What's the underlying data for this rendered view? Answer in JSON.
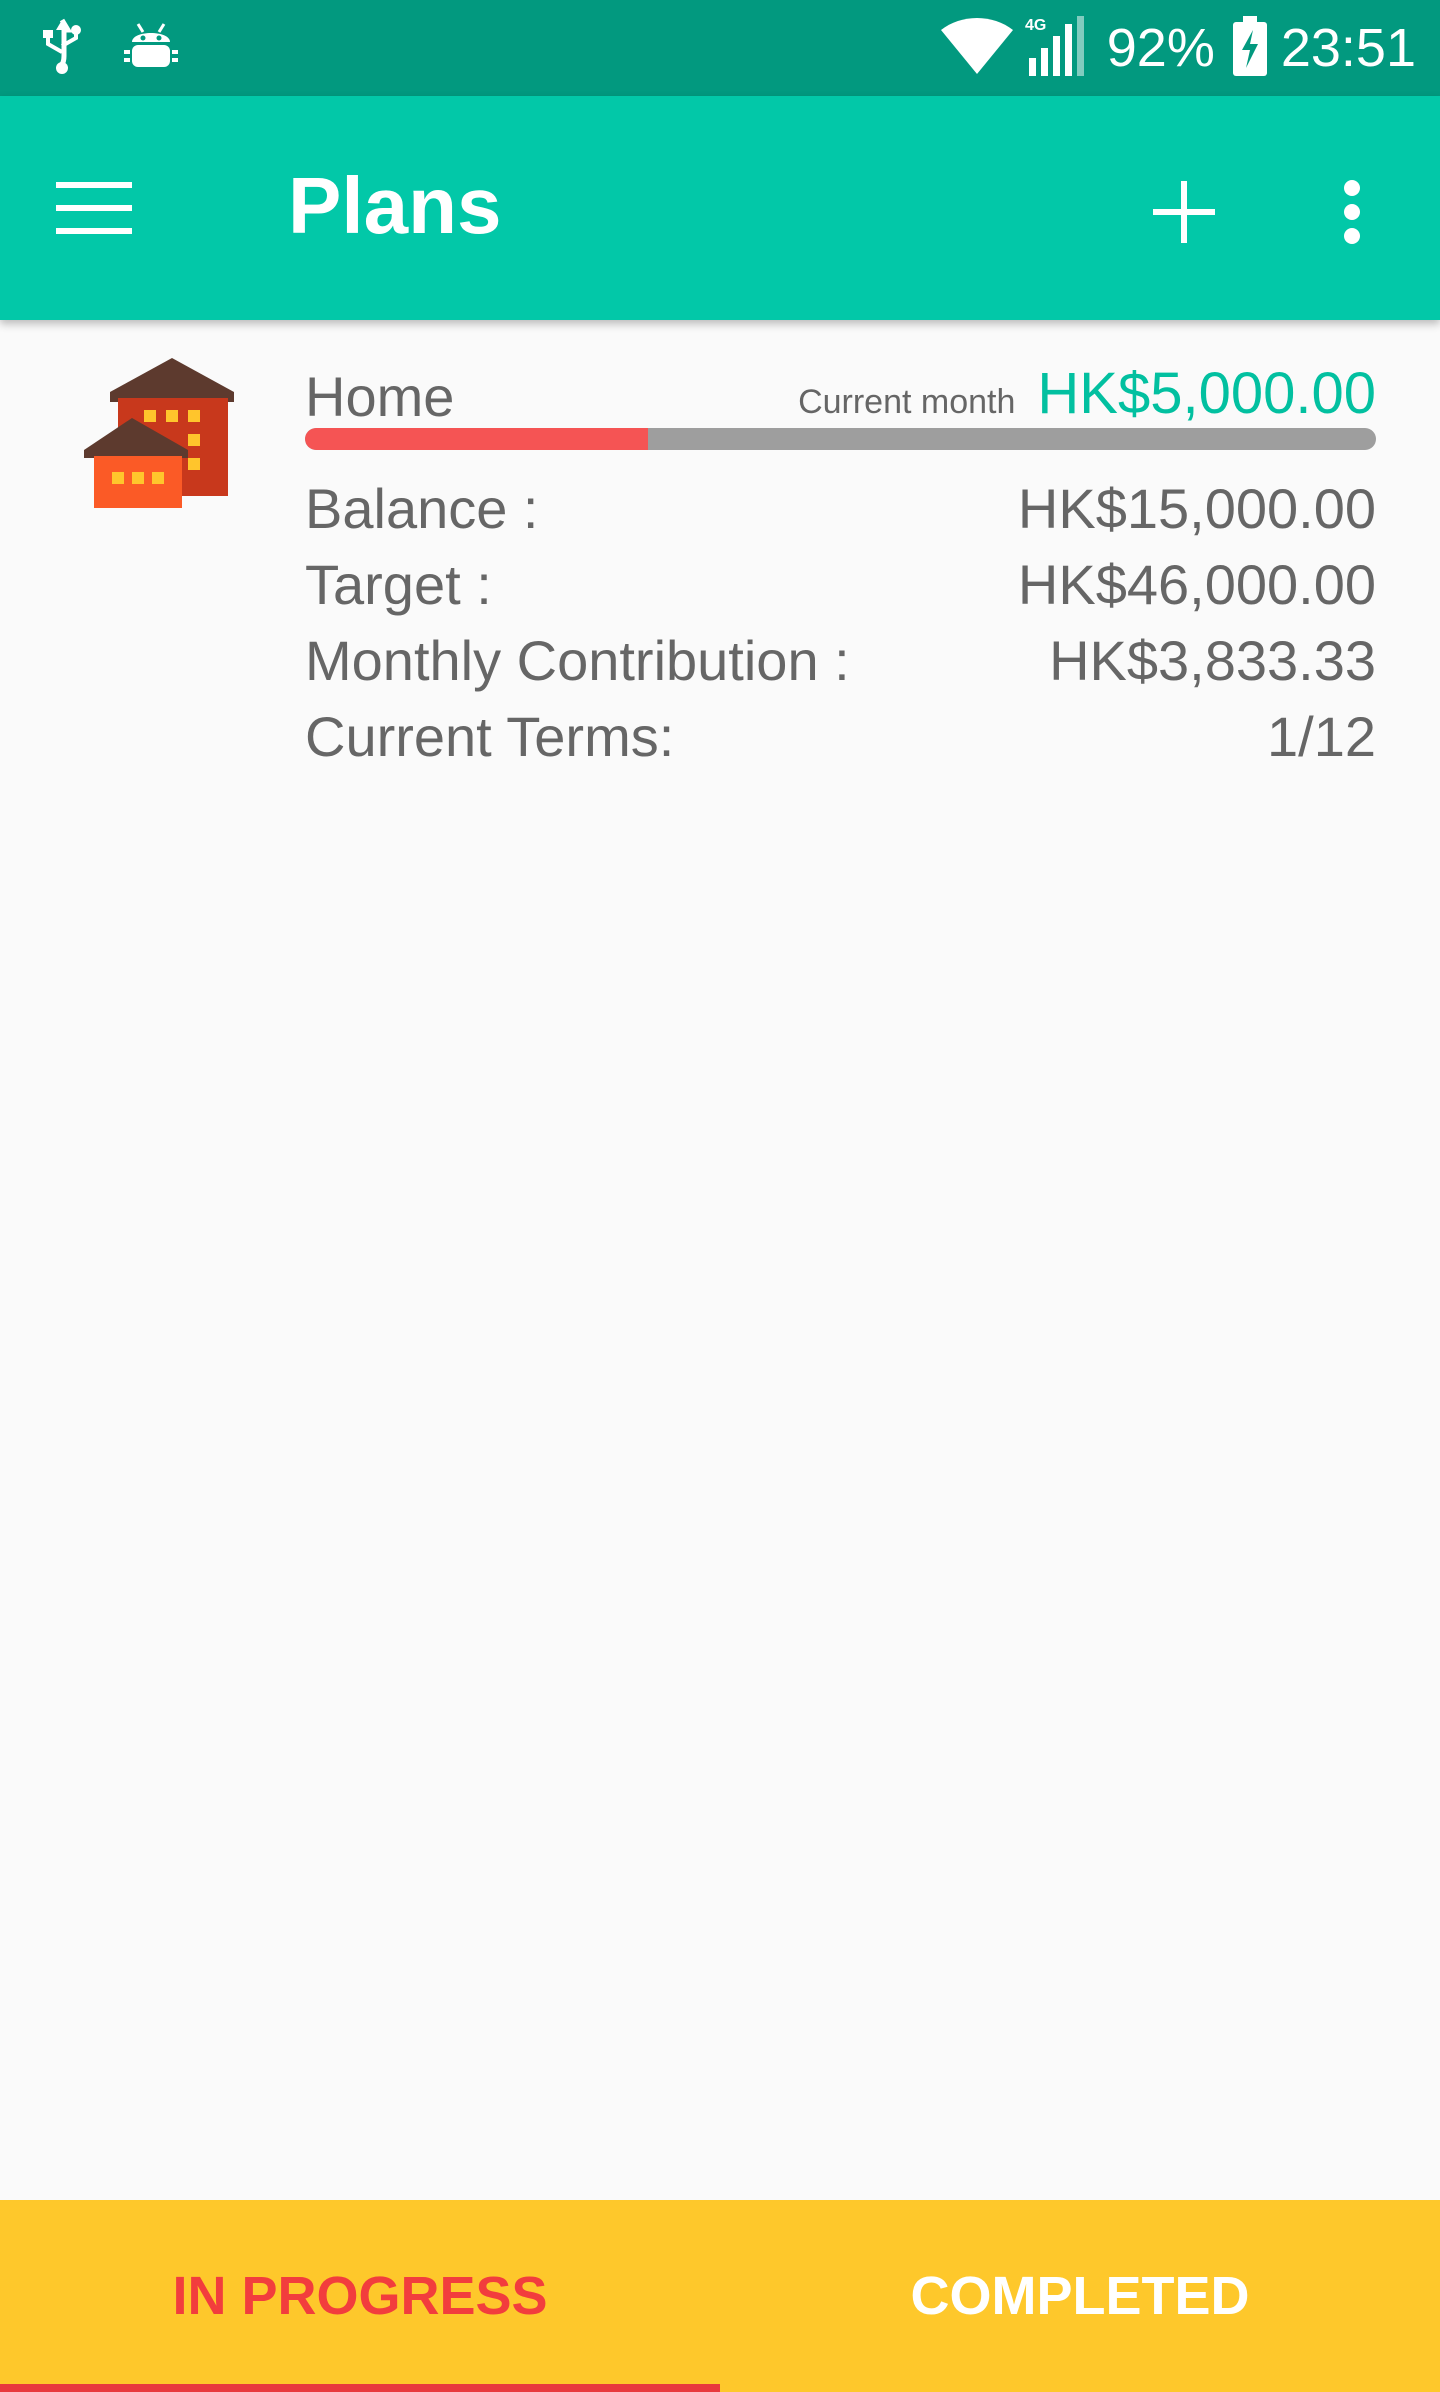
{
  "status_bar": {
    "battery_percent": "92%",
    "time": "23:51",
    "network_type": "4G",
    "icons": [
      "usb-icon",
      "android-debug-icon",
      "wifi-icon",
      "cell-signal-icon",
      "battery-charging-icon"
    ]
  },
  "app_bar": {
    "title": "Plans",
    "icons": [
      "menu-icon",
      "add-icon",
      "more-vert-icon"
    ]
  },
  "plan": {
    "name": "Home",
    "current_month_label": "Current month",
    "current_month_value": "HK$5,000.00",
    "progress_fraction": 0.32,
    "icon": "home-buildings-icon",
    "rows": [
      {
        "label": "Balance :",
        "value": "HK$15,000.00"
      },
      {
        "label": "Target :",
        "value": "HK$46,000.00"
      },
      {
        "label": "Monthly Contribution :",
        "value": "HK$3,833.33"
      },
      {
        "label": "Current Terms:",
        "value": "1/12"
      }
    ]
  },
  "tabs": [
    {
      "label": "IN PROGRESS",
      "selected": true
    },
    {
      "label": "COMPLETED",
      "selected": false
    }
  ],
  "colors": {
    "status_bar": "#02997f",
    "app_bar": "#02c8a8",
    "accent_value": "#02c0a0",
    "progress_fill": "#f55454",
    "progress_track": "#9e9e9e",
    "tab_bar": "#fec82b",
    "tab_active": "#f23d3d"
  }
}
